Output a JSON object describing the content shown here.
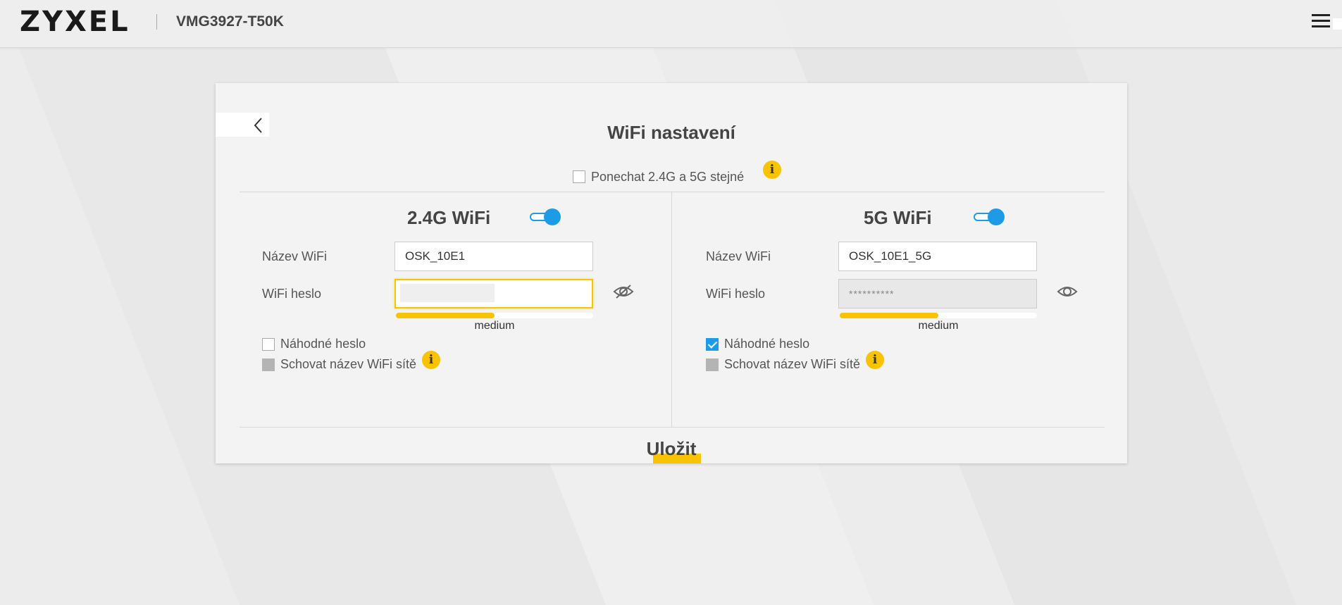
{
  "header": {
    "brand": "ZYXEL",
    "model": "VMG3927-T50K"
  },
  "page": {
    "title": "WiFi nastavení",
    "same_settings_label": "Ponechat 2.4G a 5G stejné",
    "save_label": "Uložit"
  },
  "wifi_24": {
    "title": "2.4G WiFi",
    "enabled": true,
    "name_label": "Název WiFi",
    "name_value": "OSK_10E1",
    "password_label": "WiFi heslo",
    "password_value": "",
    "strength_label": "medium",
    "strength_level": 0.5,
    "random_password_label": "Náhodné heslo",
    "random_password_checked": false,
    "hide_ssid_label": "Schovat název WiFi sítě",
    "hide_ssid_disabled": true
  },
  "wifi_5": {
    "title": "5G WiFi",
    "enabled": true,
    "name_label": "Název WiFi",
    "name_value": "OSK_10E1_5G",
    "password_label": "WiFi heslo",
    "password_value": "**********",
    "strength_label": "medium",
    "strength_level": 0.5,
    "random_password_label": "Náhodné heslo",
    "random_password_checked": true,
    "hide_ssid_label": "Schovat název WiFi sítě",
    "hide_ssid_disabled": true
  },
  "colors": {
    "accent_blue": "#1e9be6",
    "accent_yellow": "#f8c300"
  },
  "icons": {
    "back": "chevron-left-icon",
    "menu": "hamburger-icon",
    "info": "info-icon",
    "eye_hidden": "eye-off-icon",
    "eye": "eye-icon"
  }
}
